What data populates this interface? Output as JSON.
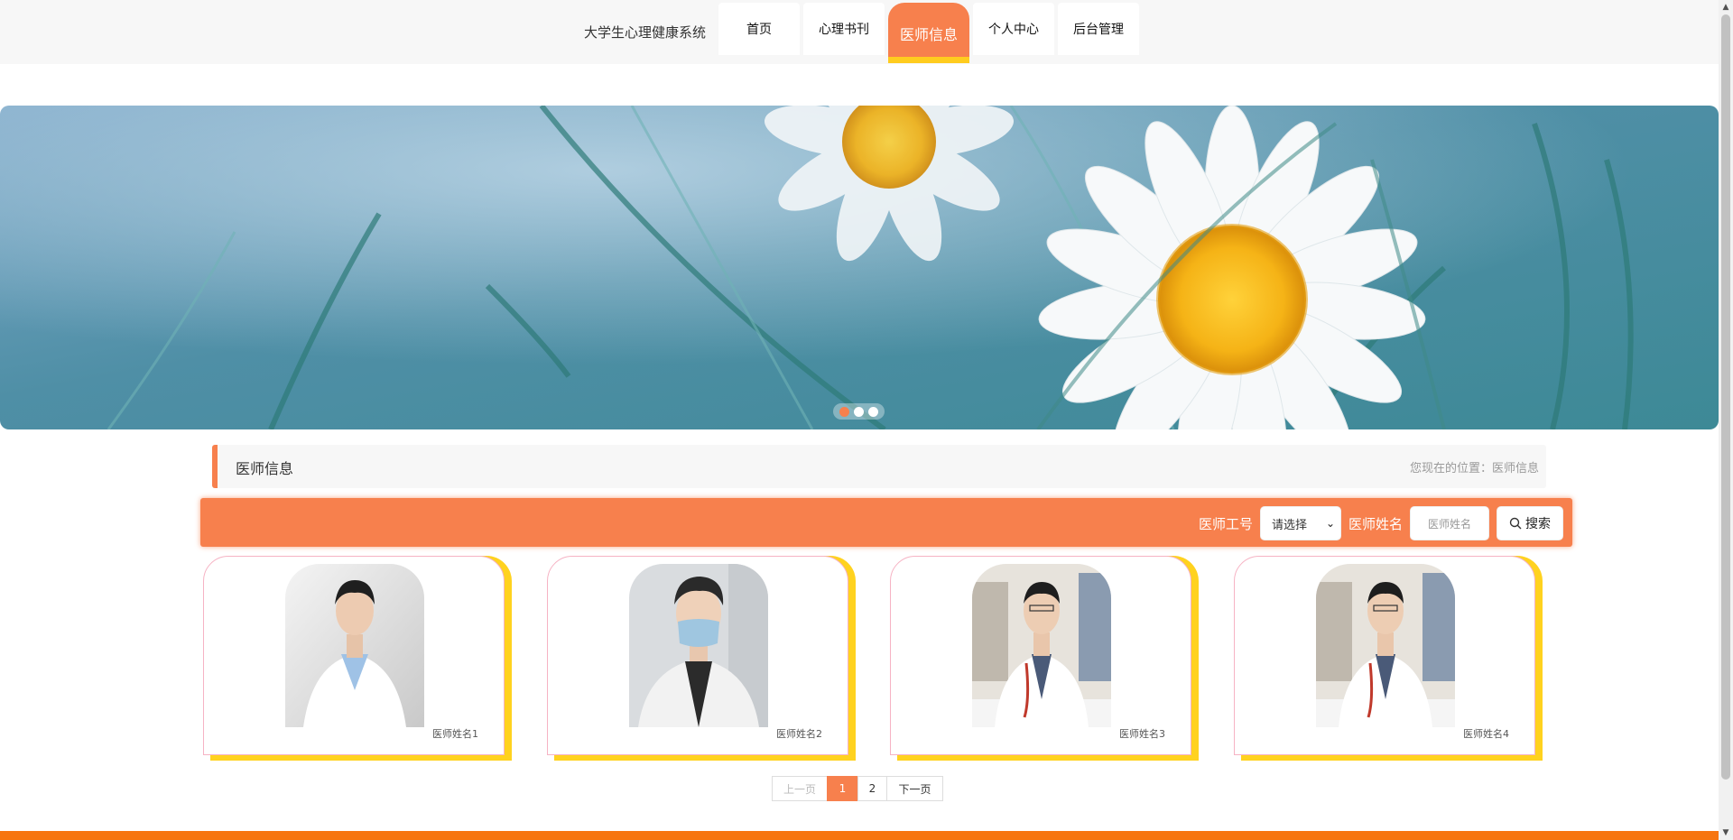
{
  "header": {
    "brand": "大学生心理健康系统",
    "nav": [
      {
        "label": "首页",
        "active": false
      },
      {
        "label": "心理书刊",
        "active": false
      },
      {
        "label": "医师信息",
        "active": true
      },
      {
        "label": "个人中心",
        "active": false
      },
      {
        "label": "后台管理",
        "active": false
      }
    ]
  },
  "banner": {
    "slide_count": 3,
    "active_slide": 1
  },
  "section": {
    "title": "医师信息",
    "location": "您现在的位置：医师信息"
  },
  "search": {
    "id_label": "医师工号",
    "select_value": "请选择",
    "name_label": "医师姓名",
    "name_placeholder": "医师姓名",
    "button_label": "搜索"
  },
  "doctors": [
    {
      "name": "医师姓名1"
    },
    {
      "name": "医师姓名2"
    },
    {
      "name": "医师姓名3"
    },
    {
      "name": "医师姓名4"
    }
  ],
  "pagination": {
    "prev": "上一页",
    "pages": [
      "1",
      "2"
    ],
    "current": "1",
    "next": "下一页"
  },
  "colors": {
    "accent": "#f7804d",
    "highlight": "#ffd21f",
    "footer": "#f7750f"
  }
}
